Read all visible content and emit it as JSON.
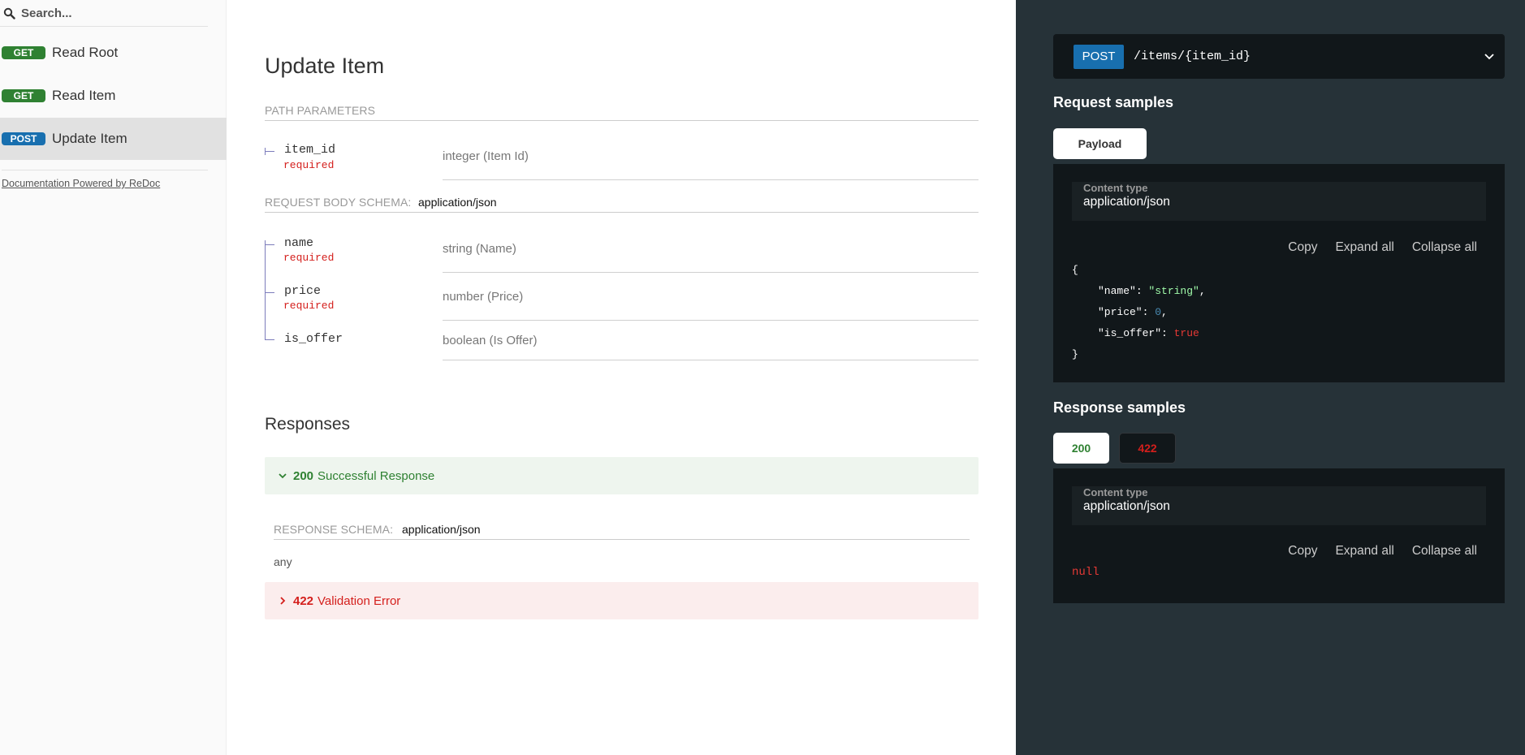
{
  "sidebar": {
    "search_placeholder": "Search...",
    "items": [
      {
        "method": "GET",
        "label": "Read Root"
      },
      {
        "method": "GET",
        "label": "Read Item"
      },
      {
        "method": "POST",
        "label": "Update Item"
      }
    ],
    "powered_by": "Documentation Powered by ReDoc"
  },
  "operation": {
    "title": "Update Item",
    "path_params_label": "PATH PARAMETERS",
    "path_params": [
      {
        "name": "item_id",
        "required": "required",
        "type": "integer (Item Id)"
      }
    ],
    "body_schema_label": "REQUEST BODY SCHEMA:",
    "body_content_type": "application/json",
    "body_params": [
      {
        "name": "name",
        "required": "required",
        "type": "string (Name)"
      },
      {
        "name": "price",
        "required": "required",
        "type": "number (Price)"
      },
      {
        "name": "is_offer",
        "required": "",
        "type": "boolean (Is Offer)"
      }
    ],
    "responses_title": "Responses",
    "responses": [
      {
        "code": "200",
        "text": "Successful Response"
      },
      {
        "code": "422",
        "text": "Validation Error"
      }
    ],
    "response_schema_label": "RESPONSE SCHEMA:",
    "response_content_type": "application/json",
    "response_any": "any"
  },
  "right": {
    "endpoint_method": "POST",
    "endpoint_path": "/items/{item_id}",
    "request_samples_title": "Request samples",
    "payload_tab": "Payload",
    "content_type_label": "Content type",
    "content_type_value": "application/json",
    "copy": "Copy",
    "expand_all": "Expand all",
    "collapse_all": "Collapse all",
    "request_json": {
      "open": "{",
      "close": "}",
      "lines": [
        {
          "key": "\"name\"",
          "value": "\"string\"",
          "kind": "string",
          "comma": ","
        },
        {
          "key": "\"price\"",
          "value": "0",
          "kind": "number",
          "comma": ","
        },
        {
          "key": "\"is_offer\"",
          "value": "true",
          "kind": "bool",
          "comma": ""
        }
      ]
    },
    "response_samples_title": "Response samples",
    "response_tabs": [
      "200",
      "422"
    ],
    "response_null": "null"
  },
  "colors": {
    "get_badge": "#2f8132",
    "post_badge": "#186faf",
    "required": "#d41f1c",
    "success": "#2f8132",
    "error": "#d41f1c",
    "right_panel_bg": "#263238"
  }
}
